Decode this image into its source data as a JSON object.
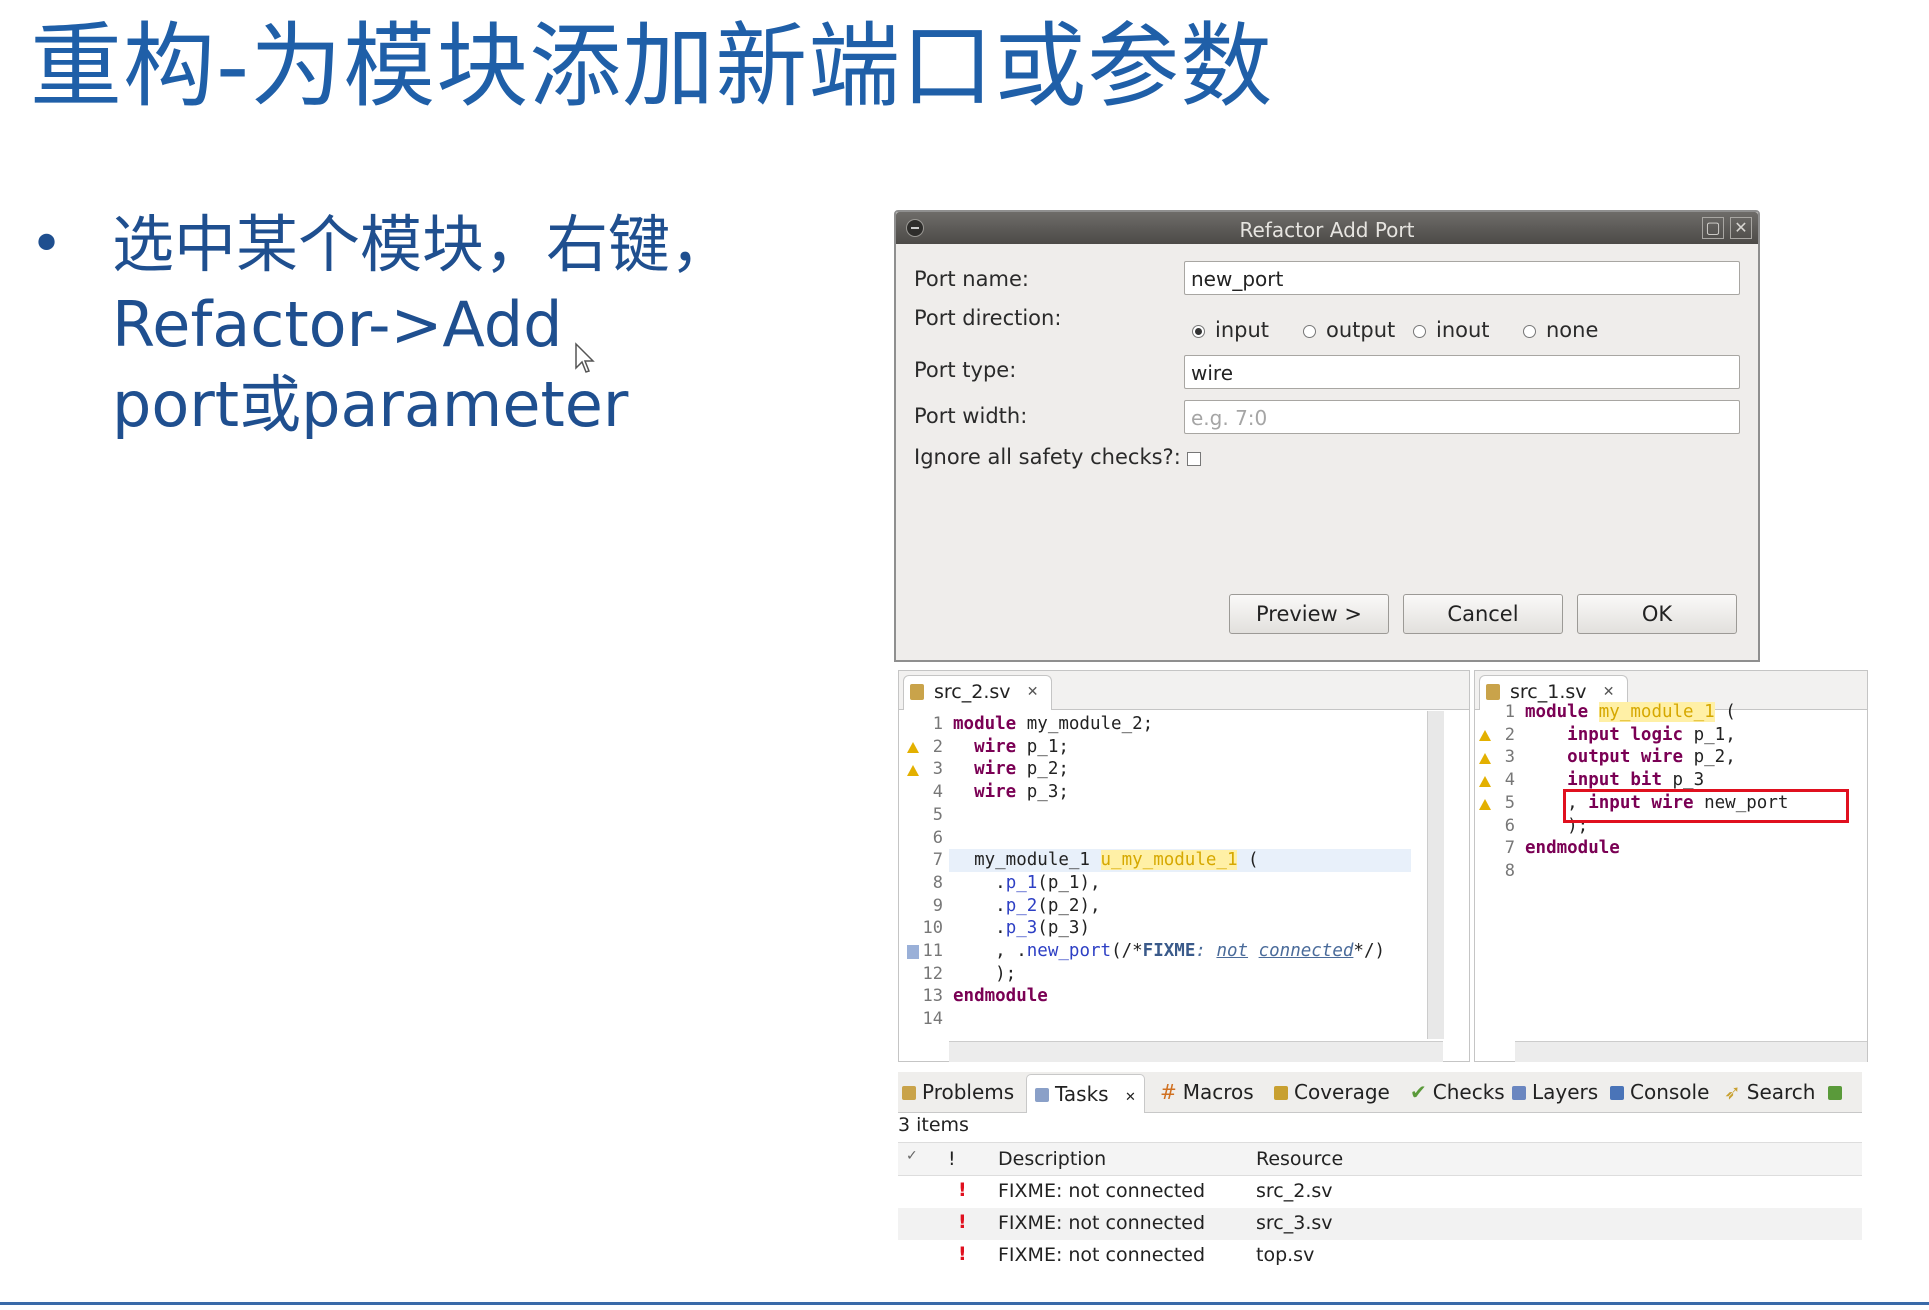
{
  "slide": {
    "title": "重构-为模块添加新端口或参数",
    "bullet_symbol": "•",
    "bullet_lines": [
      "选中某个模块，右键，",
      "Refactor->Add",
      "port或parameter"
    ]
  },
  "dialog": {
    "title": "Refactor Add Port",
    "port_name_label": "Port name:",
    "port_name_value": "new_port",
    "port_direction_label": "Port direction:",
    "directions": [
      "input",
      "output",
      "inout",
      "none"
    ],
    "selected_direction": "input",
    "port_type_label": "Port type:",
    "port_type_value": "wire",
    "port_width_label": "Port width:",
    "port_width_placeholder": "e.g. 7:0",
    "ignore_checks_label": "Ignore all safety checks?:",
    "ignore_checks_checked": false,
    "preview_label": "Preview >",
    "cancel_label": "Cancel",
    "ok_label": "OK"
  },
  "editor_left": {
    "tab": "src_2.sv",
    "line_numbers": [
      "1",
      "2",
      "3",
      "4",
      "5",
      "6",
      "7",
      "8",
      "9",
      "10",
      "11",
      "12",
      "13",
      "14"
    ]
  },
  "editor_right": {
    "tab": "src_1.sv",
    "line_numbers": [
      "1",
      "2",
      "3",
      "4",
      "5",
      "6",
      "7",
      "8"
    ]
  },
  "tasks_view": {
    "tabs": [
      "Problems",
      "Tasks",
      "Macros",
      "Coverage",
      "Checks",
      "Layers",
      "Console",
      "Search"
    ],
    "active_tab": "Tasks",
    "count_text": "3 items",
    "col_done": "✓",
    "col_priority": "!",
    "col_description": "Description",
    "col_resource": "Resource",
    "rows": [
      {
        "description": "FIXME: not connected",
        "resource": "src_2.sv"
      },
      {
        "description": "FIXME: not connected",
        "resource": "src_3.sv"
      },
      {
        "description": "FIXME: not connected",
        "resource": "top.sv"
      }
    ]
  },
  "colors": {
    "title_blue": "#1f5fa8",
    "keyword": "#7a0054",
    "highlight": "#fff0a6",
    "red_box": "#e0101f"
  }
}
